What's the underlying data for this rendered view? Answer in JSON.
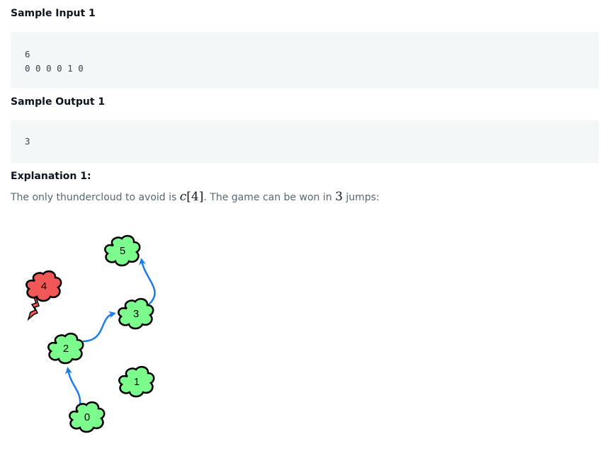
{
  "sample_input": {
    "heading": "Sample Input 1",
    "lines": [
      "6",
      "0 0 0 0 1 0"
    ]
  },
  "sample_output": {
    "heading": "Sample Output 1",
    "lines": [
      "3"
    ]
  },
  "explanation": {
    "heading": "Explanation 1:",
    "text_before": "The only thundercloud to avoid is ",
    "math_var": "c",
    "math_index": "[4]",
    "text_middle": ". The game can be won in ",
    "math_count": "3",
    "text_after": " jumps:"
  },
  "diagram": {
    "clouds": [
      {
        "label": "0",
        "type": "safe"
      },
      {
        "label": "1",
        "type": "safe"
      },
      {
        "label": "2",
        "type": "safe"
      },
      {
        "label": "3",
        "type": "safe"
      },
      {
        "label": "4",
        "type": "thunder"
      },
      {
        "label": "5",
        "type": "safe"
      }
    ],
    "jumps": [
      [
        "0",
        "2"
      ],
      [
        "2",
        "3"
      ],
      [
        "3",
        "5"
      ]
    ],
    "colors": {
      "safe": "#7cfc8c",
      "thunder": "#f25757",
      "arrow": "#1a7de8",
      "outline": "#000000"
    }
  }
}
